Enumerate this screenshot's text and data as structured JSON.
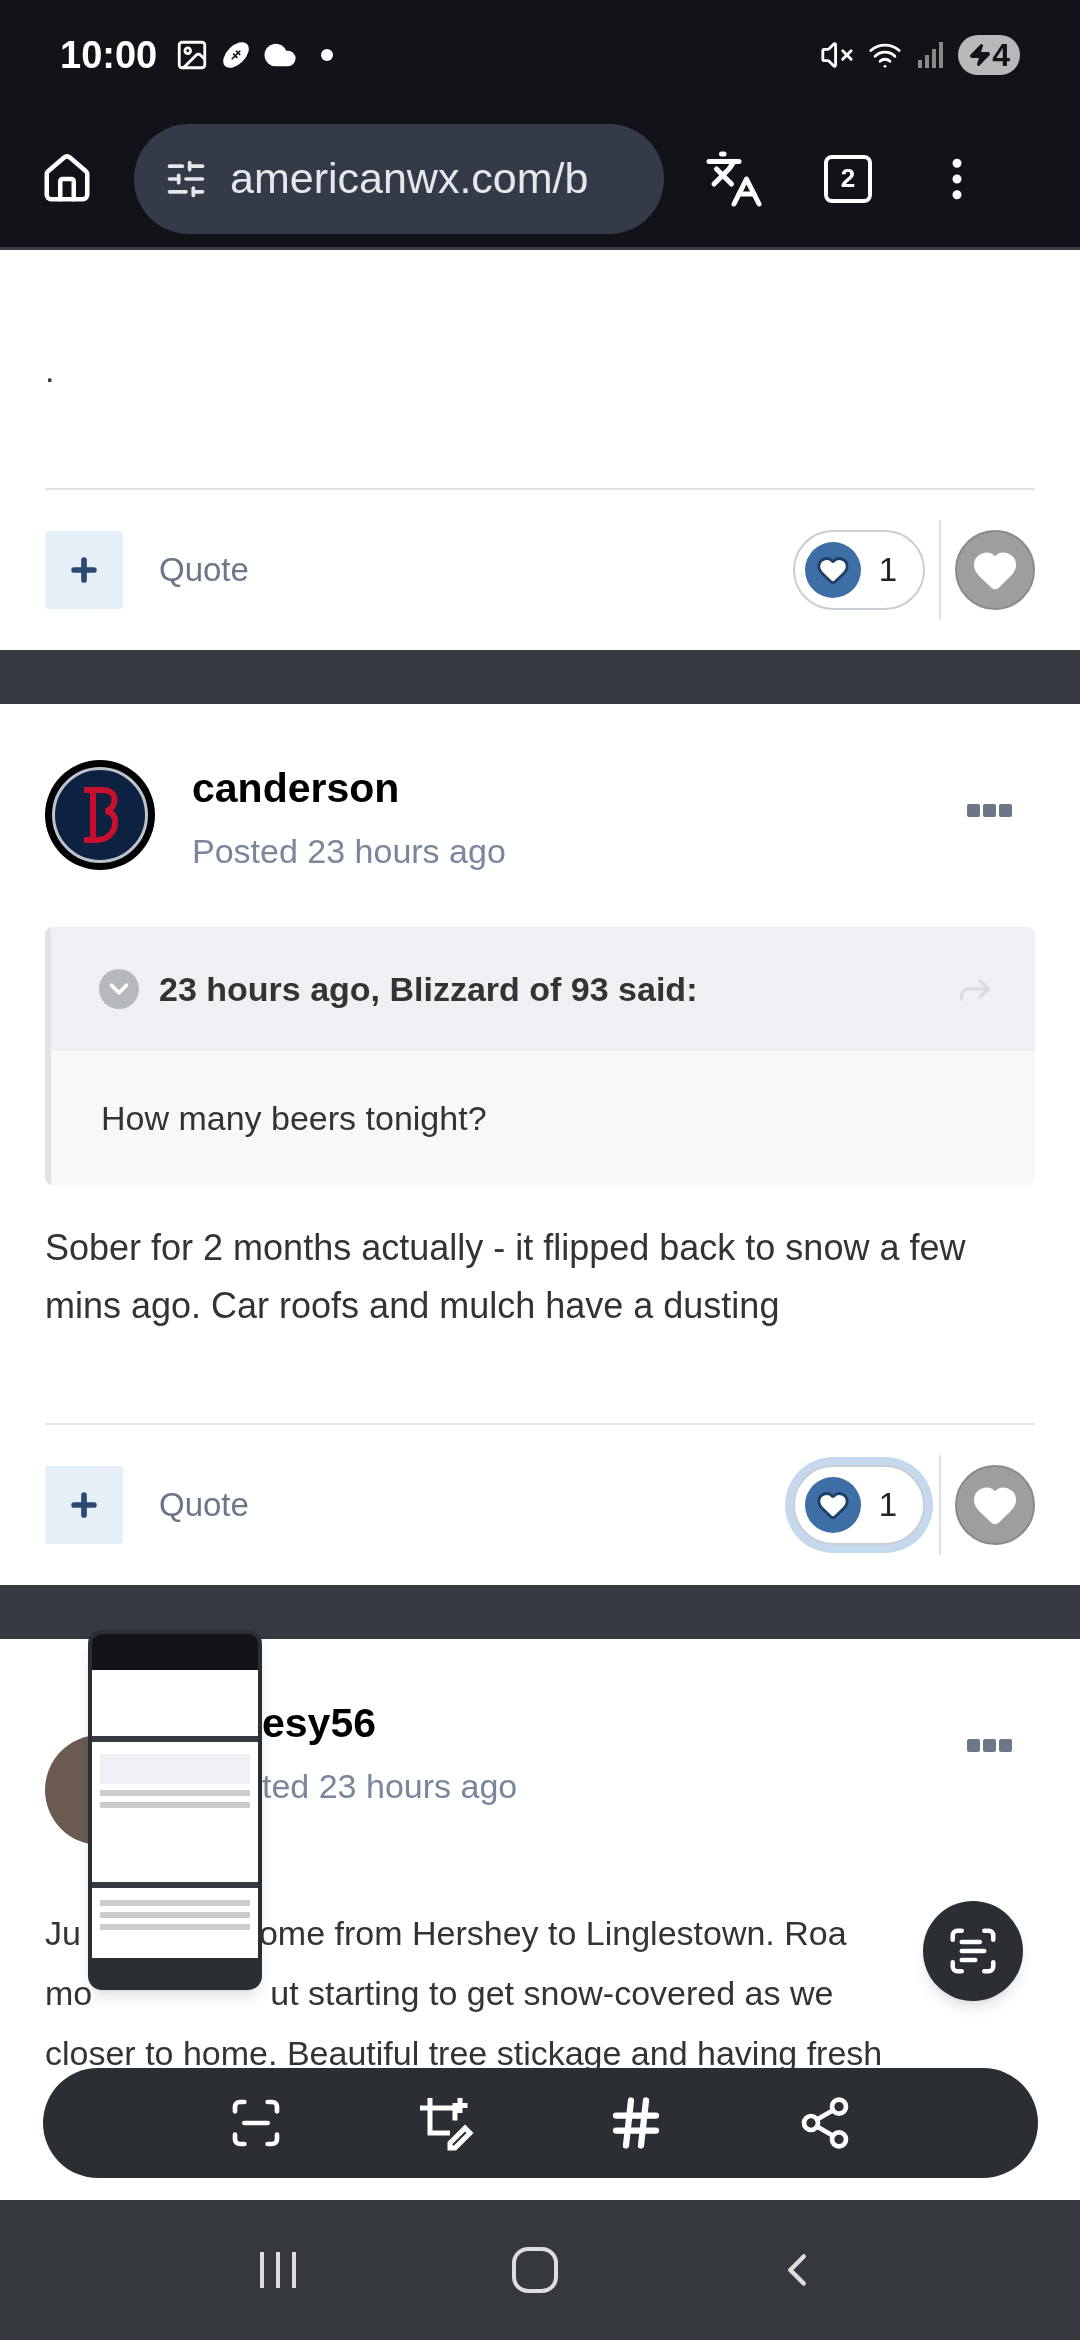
{
  "status_bar": {
    "time": "10:00",
    "battery": "4"
  },
  "browser": {
    "url": "americanwx.com/b",
    "tab_count": "2"
  },
  "posts": [
    {
      "kind": "tail",
      "body": [
        "."
      ],
      "footer": {
        "quote": "Quote",
        "likes": "1",
        "focused": false
      }
    },
    {
      "kind": "full",
      "author": "canderson",
      "posted": "Posted 23 hours ago",
      "quote": {
        "header": "23 hours ago, Blizzard of 93 said:",
        "text": "How many beers tonight?"
      },
      "body": [
        "Sober for 2 months actually - it flipped back to snow a few mins ago. Car roofs and mulch have a dusting"
      ],
      "footer": {
        "quote": "Quote",
        "likes": "1",
        "focused": true
      }
    },
    {
      "kind": "covered",
      "author": "esy56",
      "posted": "ted 23 hours ago",
      "lines": [
        [
          "Ju",
          "ome from Hershey to Linglestown. Roa"
        ],
        [
          "mo",
          "ut starting to get snow-covered as we"
        ],
        [
          "closer to home. Beautiful tree stickage and having fresh"
        ]
      ]
    }
  ]
}
